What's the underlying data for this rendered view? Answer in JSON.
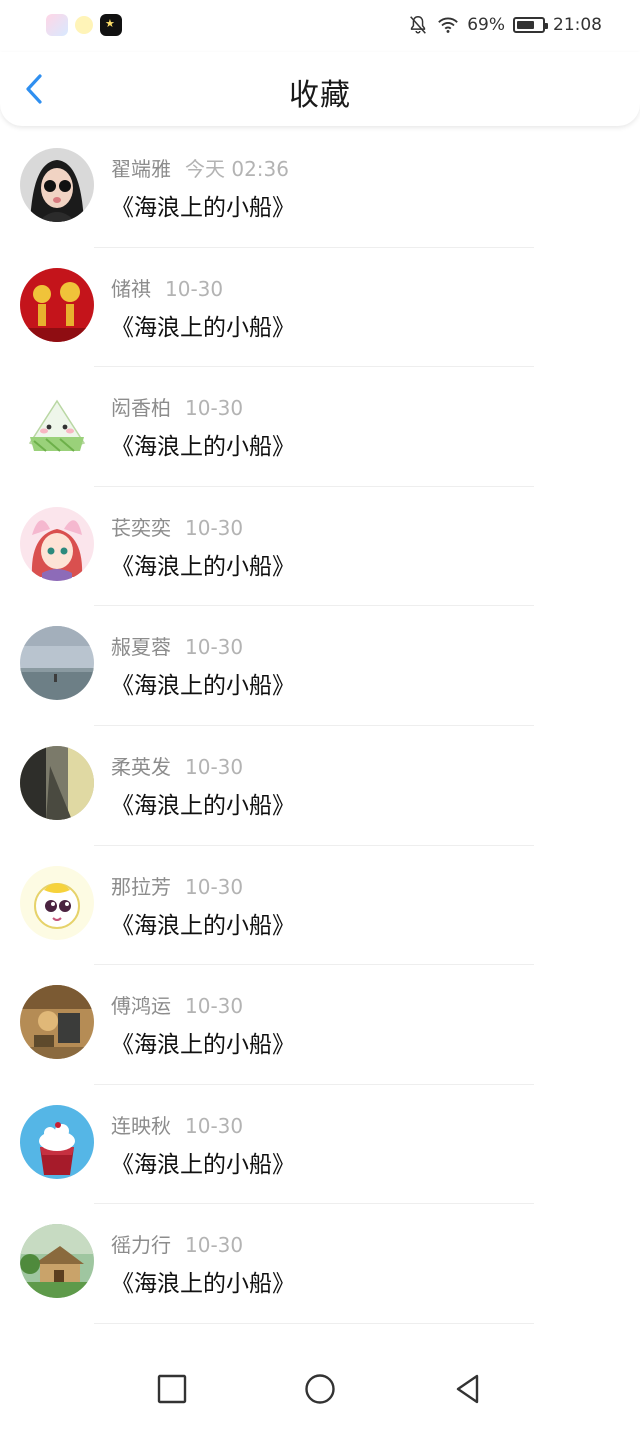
{
  "status_bar": {
    "battery": "69%",
    "battery_level": 0.69,
    "time": "21:08",
    "icons": [
      "notifications-off-icon",
      "wifi-icon",
      "battery-icon"
    ]
  },
  "header": {
    "title": "收藏",
    "back_icon": "chevron-left-icon",
    "accent_color": "#2f8ff0"
  },
  "items": [
    {
      "name": "翟端雅",
      "time": "今天 02:36",
      "title": "《海浪上的小船》"
    },
    {
      "name": "储祺",
      "time": "10-30",
      "title": "《海浪上的小船》"
    },
    {
      "name": "闳香柏",
      "time": "10-30",
      "title": "《海浪上的小船》"
    },
    {
      "name": "苌奕奕",
      "time": "10-30",
      "title": "《海浪上的小船》"
    },
    {
      "name": "赧夏蓉",
      "time": "10-30",
      "title": "《海浪上的小船》"
    },
    {
      "name": "柔英发",
      "time": "10-30",
      "title": "《海浪上的小船》"
    },
    {
      "name": "那拉芳",
      "time": "10-30",
      "title": "《海浪上的小船》"
    },
    {
      "name": "傅鸿运",
      "time": "10-30",
      "title": "《海浪上的小船》"
    },
    {
      "name": "连映秋",
      "time": "10-30",
      "title": "《海浪上的小船》"
    },
    {
      "name": "徭力行",
      "time": "10-30",
      "title": "《海浪上的小船》"
    }
  ],
  "nav_bar": {
    "icons": [
      "recent-apps-icon",
      "home-icon",
      "back-icon"
    ]
  }
}
